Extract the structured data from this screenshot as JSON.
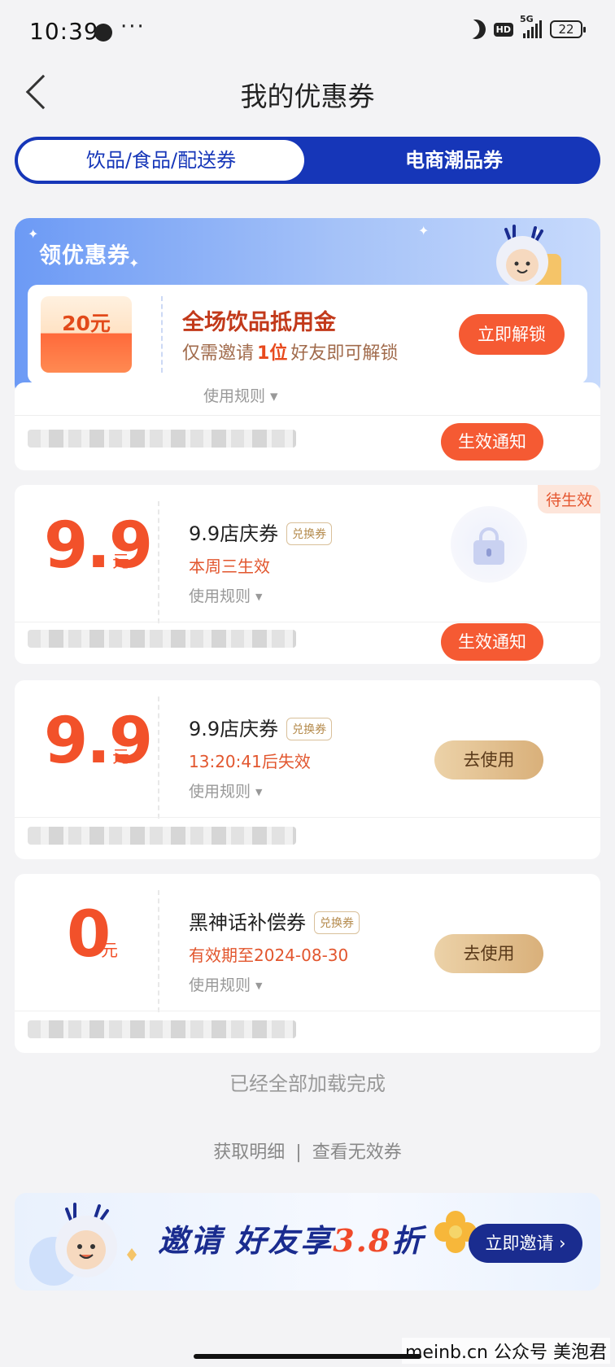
{
  "status_bar": {
    "time": "10:39",
    "more": "···",
    "network": "5G",
    "hd": "HD",
    "battery": "22"
  },
  "header": {
    "title": "我的优惠券"
  },
  "tabs": [
    {
      "label": "饮品/食品/配送券",
      "active": true
    },
    {
      "label": "电商潮品券",
      "active": false
    }
  ],
  "promo": {
    "title": "领优惠券",
    "envelope_amount": "20元",
    "headline": "全场饮品抵用金",
    "desc_prefix": "仅需邀请",
    "desc_highlight": "1位",
    "desc_suffix": "好友即可解锁",
    "button": "立即解锁"
  },
  "coupons": [
    {
      "rule_label": "使用规则",
      "button": "生效通知"
    },
    {
      "amount": "9.9",
      "unit": "元",
      "name": "9.9店庆券",
      "tag": "兑换券",
      "status": "本周三生效",
      "rule_label": "使用规则",
      "badge": "待生效",
      "button": "生效通知"
    },
    {
      "amount": "9.9",
      "unit": "元",
      "name": "9.9店庆券",
      "tag": "兑换券",
      "status": "13:20:41后失效",
      "rule_label": "使用规则",
      "button": "去使用"
    },
    {
      "amount": "0",
      "unit": "元",
      "name": "黑神话补偿券",
      "tag": "兑换券",
      "status": "有效期至2024-08-30",
      "rule_label": "使用规则",
      "button": "去使用"
    }
  ],
  "list_end": "已经全部加载完成",
  "footer_links": {
    "details": "获取明细",
    "separator": "|",
    "invalid": "查看无效券"
  },
  "invite_banner": {
    "text_prefix": "邀请 好友享",
    "discount": "3.8",
    "text_suffix": "折",
    "button": "立即邀请"
  },
  "watermark": "meinb.cn  公众号 美泡君",
  "colors": {
    "brand_blue": "#1636b8",
    "accent_red": "#f55a33",
    "price_red": "#f2512a",
    "gold": "#d9b07a"
  }
}
